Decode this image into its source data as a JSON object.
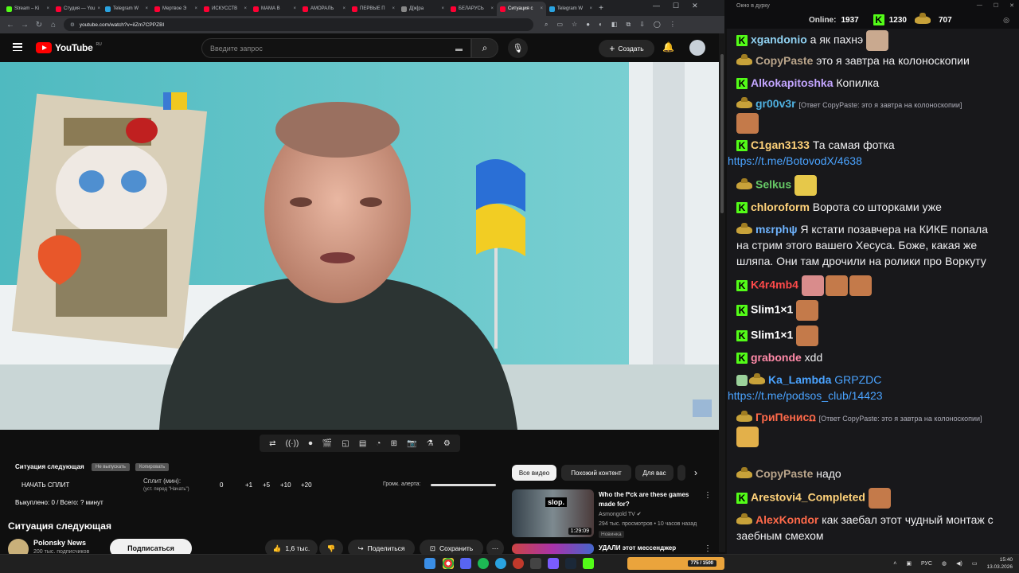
{
  "browser": {
    "tabs": [
      {
        "title": "Stream – Ki",
        "color": "#53fc18",
        "active": false
      },
      {
        "title": "Студия — You",
        "color": "#ff0033",
        "active": false
      },
      {
        "title": "Telegram W",
        "color": "#2aa3e0",
        "active": false
      },
      {
        "title": "Мертвое Э",
        "color": "#ff0033",
        "active": false
      },
      {
        "title": "ИСКУССТВ",
        "color": "#ff0033",
        "active": false
      },
      {
        "title": "МАМА В",
        "color": "#ff0033",
        "active": false
      },
      {
        "title": "АМОРАЛЬ",
        "color": "#ff0033",
        "active": false
      },
      {
        "title": "ПЕРВЫЕ П",
        "color": "#ff0033",
        "active": false
      },
      {
        "title": "Д[ж]ра",
        "color": "#888888",
        "active": false
      },
      {
        "title": "БЕЛАРУСЬ",
        "color": "#ff0033",
        "active": false
      },
      {
        "title": "Ситуация с",
        "color": "#ff0033",
        "active": true
      },
      {
        "title": "Telegram W",
        "color": "#2aa3e0",
        "active": false
      }
    ],
    "new_tab": "+",
    "url": "youtube.com/watch?v=iIZm7CPPZBI"
  },
  "youtube": {
    "logo_text": "YouTube",
    "logo_region": "RU",
    "search_placeholder": "Введите запрос",
    "create_label": "Создать",
    "video_title": "Ситуация следующая",
    "channel_name": "Polonsky News",
    "channel_subs": "200 тыс. подписчиков",
    "subscribe_label": "Подписаться",
    "likes": "1,6 тыс.",
    "share_label": "Поделиться",
    "save_label": "Сохранить",
    "chips": [
      "Все видео",
      "Похожий контент",
      "Для вас"
    ],
    "recommendations": [
      {
        "title": "Who the f*ck are these games made for?",
        "channel": "Asmongold TV",
        "meta": "294 тыс. просмотров • 10 часов назад",
        "badge": "Новинка",
        "duration": "1:29:09"
      },
      {
        "title": "УДАЛИ этот мессенджер",
        "channel": "",
        "meta": "",
        "badge": "",
        "duration": ""
      }
    ]
  },
  "split_panel": {
    "title": "Ситуация следующая",
    "btn_hide": "Не выпускать",
    "btn_copy": "Копировать",
    "start_split": "НАЧАТЬ СПЛИТ",
    "split_label": "Сплит (мин):",
    "split_hint": "(уст. перед \"Начать\")",
    "split_value": "0",
    "increments": [
      "+1",
      "+5",
      "+10",
      "+20"
    ],
    "volume_label": "Громк. алерта:",
    "paid_label": "Выкуплено: 0 / Всего: ? минут"
  },
  "chat": {
    "window_title": "Окно в дурку",
    "online_label": "Online:",
    "online_count": "1937",
    "kick_count": "1230",
    "hat_count": "707",
    "messages": [
      {
        "badge": "kick",
        "nick": "xgandonio",
        "color": "#8fd0f0",
        "text": "а як пахнэ",
        "emotes": 1
      },
      {
        "badge": "hat",
        "nick": "CopyPaste",
        "color": "#b9a48a",
        "text": "это я завтра на колоноскопии"
      },
      {
        "badge": "kick",
        "nick": "Alkokapitoshka",
        "color": "#c3a5ff",
        "text": "Копилка"
      },
      {
        "badge": "hat",
        "nick": "gr00v3r",
        "color": "#4fb0e0",
        "reply": "[Ответ CopyPaste: это я завтра на колоноскопии]",
        "emotes": 1
      },
      {
        "badge": "kick",
        "nick": "C1gan3133",
        "color": "#ffd27a",
        "text": "Та самая фотка",
        "link": "https://t.me/BotovodX/4638"
      },
      {
        "badge": "hat",
        "nick": "Selkus",
        "color": "#66c866",
        "text": "",
        "emotes": 1
      },
      {
        "badge": "kick",
        "nick": "chloroform",
        "color": "#ffd27a",
        "text": "Ворота со шторками уже"
      },
      {
        "badge": "hat",
        "nick": "mɛrphψ",
        "color": "#6fb4ff",
        "text": "Я кстати позавчера на КИКЕ попала на стрим этого вашего Хесуса. Боже, какая же шляпа. Они там дрочили на ролики про Воркуту"
      },
      {
        "badge": "kick",
        "nick": "K4r4mb4",
        "color": "#ff4a4a",
        "text": "",
        "emotes": 3
      },
      {
        "badge": "kick",
        "nick": "Slim1×1",
        "color": "#ffffff",
        "text": "",
        "emotes": 1
      },
      {
        "badge": "kick",
        "nick": "Slim1×1",
        "color": "#ffffff",
        "text": "",
        "emotes": 1
      },
      {
        "badge": "kick",
        "nick": "grabonde",
        "color": "#ff8aa8",
        "text": "xdd"
      },
      {
        "badge": "mod",
        "nick": "Ka_Lambda",
        "color": "#4aa3ff",
        "text": "GRPZDC",
        "link": "https://t.me/podsos_club/14423"
      },
      {
        "badge": "hat",
        "nick": "ГриПенисꭥ",
        "color": "#ff6a4a",
        "reply": "[Ответ CopyPaste: это я завтра на колоноскопии]",
        "emotes": 1
      },
      {
        "badge": "hat",
        "nick": "CopyPaste",
        "color": "#b9a48a",
        "text": "надо"
      },
      {
        "badge": "kick",
        "nick": "Arestovi4_Completed",
        "color": "#ffd27a",
        "text": "",
        "emotes": 1
      },
      {
        "badge": "hat",
        "nick": "AlexKondor",
        "color": "#ff6a4a",
        "text": "как заебал этот чудный монтаж с заебным смехом"
      }
    ]
  },
  "taskbar": {
    "lang": "РУС",
    "time": "15:40",
    "date": "13.03.2026",
    "widget_text": "775 / 1500"
  }
}
